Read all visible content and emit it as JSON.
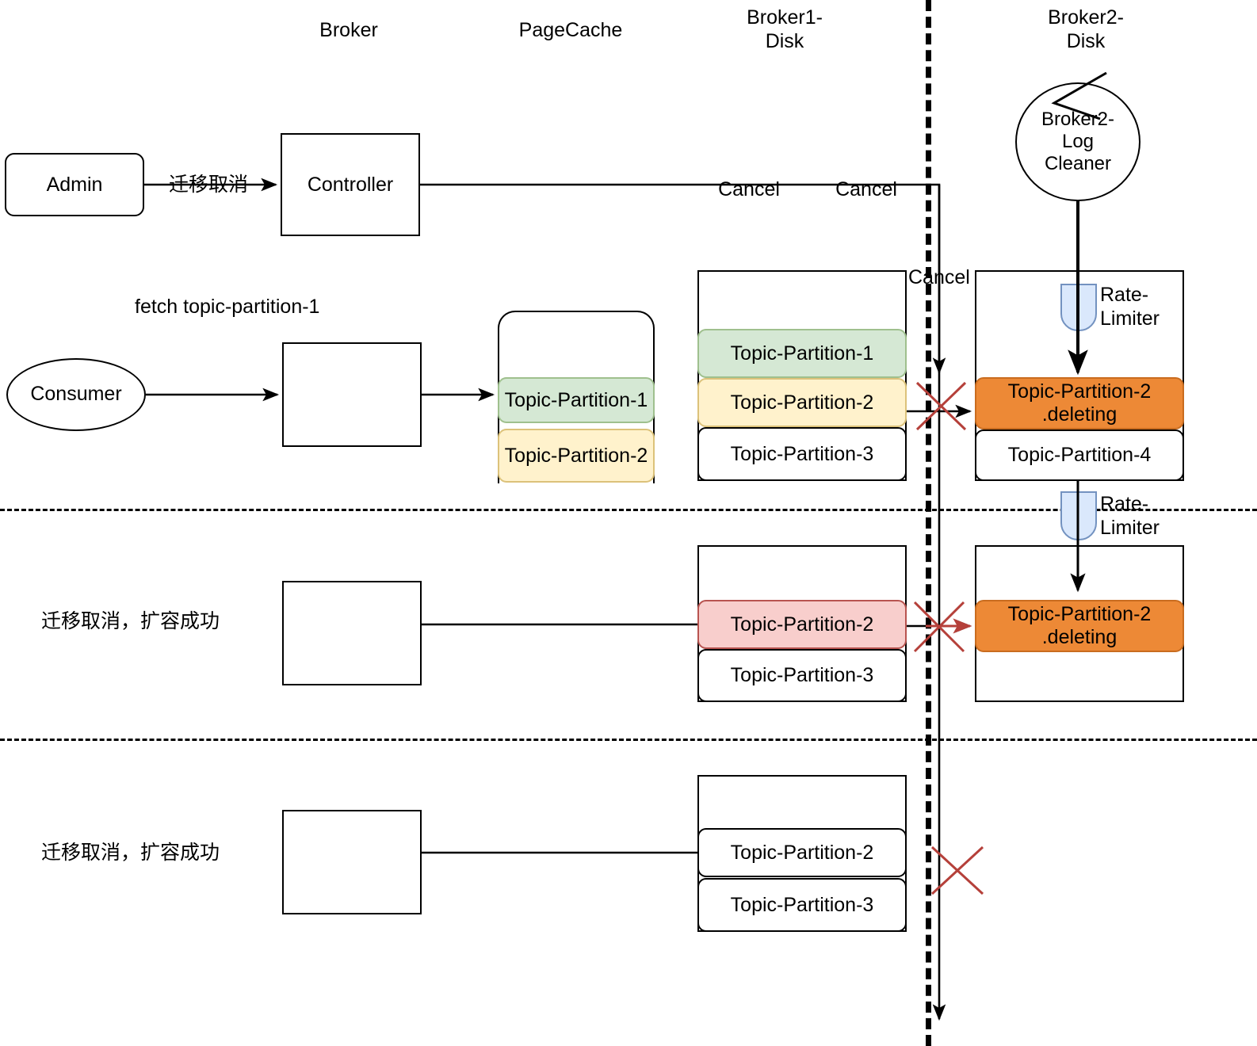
{
  "column_headers": [
    {
      "label": "Broker"
    },
    {
      "label": "PageCache"
    },
    {
      "label": "Broker1-\nDisk"
    },
    {
      "label": "Broker2-\nDisk"
    }
  ],
  "row1": {
    "admin_label": "Admin",
    "admin_to_controller_label": "迁移取消",
    "controller_label": "Controller",
    "cancel_label_1": "Cancel",
    "cancel_label_2": "Cancel",
    "cancel_label_3": "Cancel",
    "log_cleaner_label": "Broker2-\nLog\nCleaner",
    "consumer_label": "Consumer",
    "fetch_label": "fetch topic-partition-1",
    "rate_limiter_top": "Rate-\nLimiter",
    "rate_limiter_bottom": "Rate-\nLimiter",
    "pagecache_partitions": [
      {
        "label": "Topic-Partition-1",
        "color": "green"
      },
      {
        "label": "Topic-Partition-2",
        "color": "yellow"
      }
    ],
    "broker1_disk_partitions": [
      {
        "label": "Topic-Partition-1",
        "color": "green"
      },
      {
        "label": "Topic-Partition-2",
        "color": "yellow"
      },
      {
        "label": "Topic-Partition-3",
        "color": "white"
      }
    ],
    "broker2_disk_partitions": [
      {
        "label": "Topic-Partition-2\n.deleting",
        "color": "orange"
      },
      {
        "label": "Topic-Partition-4",
        "color": "white"
      }
    ]
  },
  "row2": {
    "status_label": "迁移取消，扩容成功",
    "broker1_disk_partitions": [
      {
        "label": "Topic-Partition-2",
        "color": "pink"
      },
      {
        "label": "Topic-Partition-3",
        "color": "white"
      }
    ],
    "broker2_disk_partitions": [
      {
        "label": "Topic-Partition-2\n.deleting",
        "color": "orange"
      }
    ]
  },
  "row3": {
    "status_label": "迁移取消，扩容成功",
    "broker1_disk_partitions": [
      {
        "label": "Topic-Partition-2",
        "color": "white"
      },
      {
        "label": "Topic-Partition-3",
        "color": "white"
      }
    ]
  },
  "colors": {
    "green_fill": "#d5e8d4",
    "green_stroke": "#9fc08e",
    "yellow_fill": "#fff2cc",
    "yellow_stroke": "#dcc27a",
    "pink_fill": "#f8cecc",
    "pink_stroke": "#b85450",
    "orange_fill": "#ed8936",
    "orange_stroke": "#c96c1f",
    "rate_limiter_fill": "#dae8fc",
    "rate_limiter_stroke": "#7392c0",
    "x_mark": "#b5403a",
    "stroke": "#000000"
  }
}
